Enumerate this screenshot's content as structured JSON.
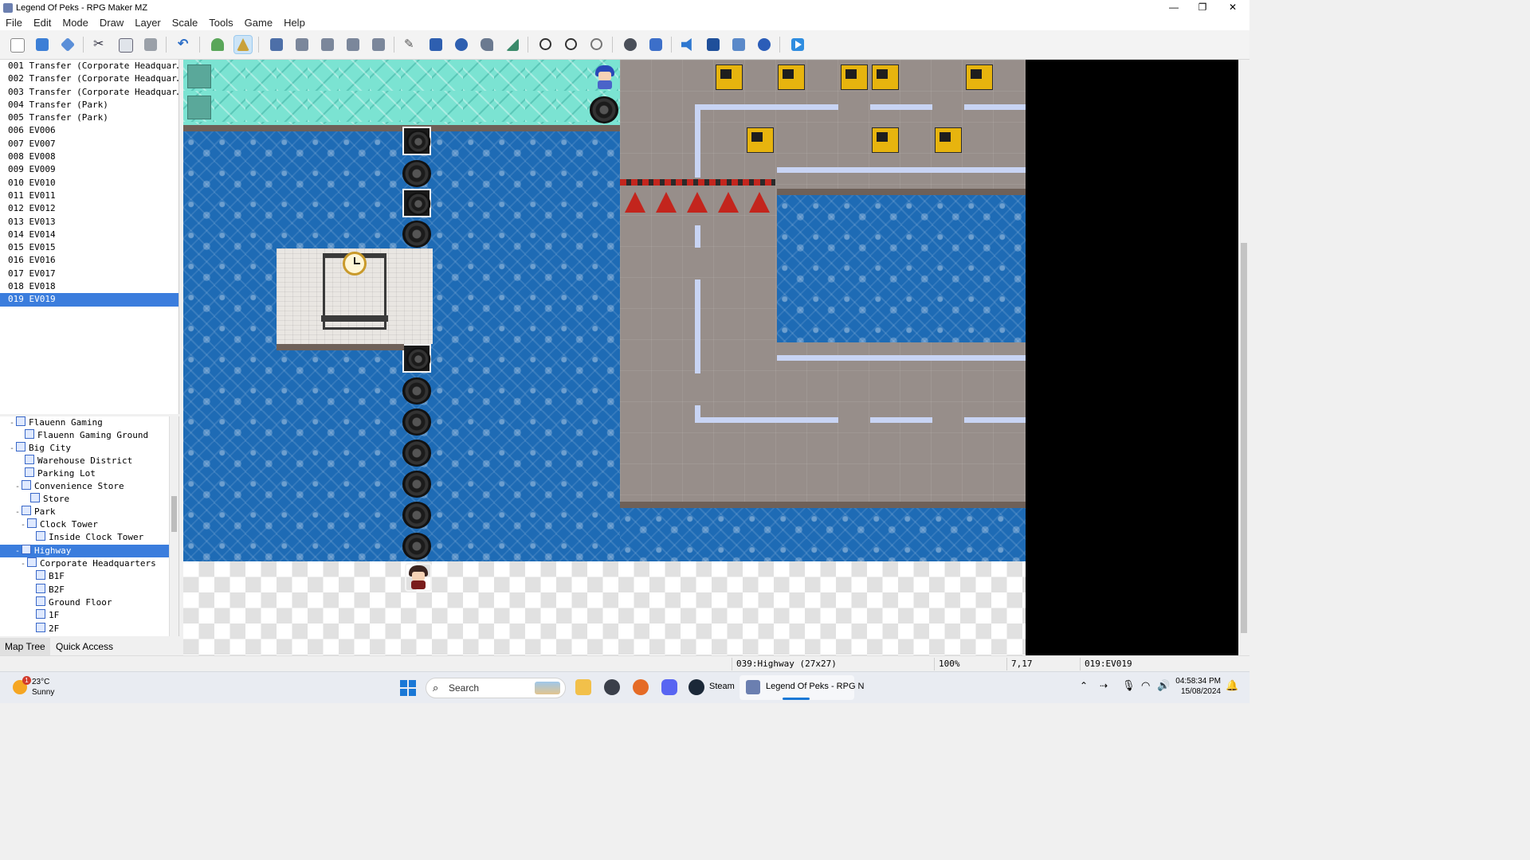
{
  "window": {
    "title": "Legend Of Peks - RPG Maker MZ",
    "controls": {
      "minimize": "—",
      "maximize": "❐",
      "close": "✕"
    }
  },
  "menu": [
    "File",
    "Edit",
    "Mode",
    "Draw",
    "Layer",
    "Scale",
    "Tools",
    "Game",
    "Help"
  ],
  "toolbar": {
    "icons": [
      "new-project",
      "open-project",
      "save-project",
      "cut",
      "copy",
      "paste",
      "undo",
      "map-mode",
      "event-mode",
      "layer-a",
      "layer-b",
      "layer-c",
      "layer-d",
      "layer-auto",
      "pencil",
      "rectangle",
      "ellipse",
      "flood-fill",
      "shadow-pen",
      "zoom-in",
      "zoom-out",
      "actual-size",
      "database",
      "plugin-manager",
      "sound-test",
      "event-searcher",
      "resource-manager",
      "character-generator",
      "playtest"
    ],
    "active": [
      "event-mode"
    ]
  },
  "events": [
    "001 Transfer (Corporate Headquar…",
    "002 Transfer (Corporate Headquar…",
    "003 Transfer (Corporate Headquar…",
    "004 Transfer (Park)",
    "005 Transfer (Park)",
    "006 EV006",
    "007 EV007",
    "008 EV008",
    "009 EV009",
    "010 EV010",
    "011 EV011",
    "012 EV012",
    "013 EV013",
    "014 EV014",
    "015 EV015",
    "016 EV016",
    "017 EV017",
    "018 EV018",
    "019 EV019"
  ],
  "selected_event": "019 EV019",
  "map_tree": [
    {
      "label": "Flauenn Gaming",
      "toggle": "-",
      "depth": 1
    },
    {
      "label": "Flauenn Gaming Ground",
      "toggle": "",
      "depth": 2
    },
    {
      "label": "Big City",
      "toggle": "-",
      "depth": 1
    },
    {
      "label": "Warehouse District",
      "toggle": "",
      "depth": 2
    },
    {
      "label": "Parking Lot",
      "toggle": "",
      "depth": 2
    },
    {
      "label": "Convenience Store",
      "toggle": "-",
      "depth": 2
    },
    {
      "label": "Store",
      "toggle": "",
      "depth": 3
    },
    {
      "label": "Park",
      "toggle": "-",
      "depth": 2
    },
    {
      "label": "Clock Tower",
      "toggle": "-",
      "depth": 3
    },
    {
      "label": "Inside Clock Tower",
      "toggle": "",
      "depth": 4
    },
    {
      "label": "Highway",
      "toggle": "-",
      "depth": 1
    },
    {
      "label": "Corporate Headquarters",
      "toggle": "-",
      "depth": 2
    },
    {
      "label": "B1F",
      "toggle": "",
      "depth": 3
    },
    {
      "label": "B2F",
      "toggle": "",
      "depth": 3
    },
    {
      "label": "Ground Floor",
      "toggle": "",
      "depth": 3
    },
    {
      "label": "1F",
      "toggle": "",
      "depth": 3
    },
    {
      "label": "2F",
      "toggle": "",
      "depth": 3
    }
  ],
  "selected_map": "Highway",
  "bottom_tabs": [
    "Map Tree",
    "Quick Access"
  ],
  "status": {
    "map": "039:Highway (27x27)",
    "zoom": "100%",
    "coords": "7,17",
    "event": "019:EV019"
  },
  "taskbar": {
    "weather_temp": "23°C",
    "weather_desc": "Sunny",
    "weather_badge": "1",
    "search_placeholder": "Search",
    "steam_label": "Steam",
    "active_app_label": "Legend Of Peks - RPG N",
    "time": "04:58:34 PM",
    "date": "15/08/2024"
  },
  "colors": {
    "selection": "#3b7ddd",
    "water": "#1e6bb5",
    "floor_tiles": "#7be3d2",
    "asphalt": "#978e8a",
    "dozer": "#e7b40e",
    "cone": "#c3251d"
  }
}
